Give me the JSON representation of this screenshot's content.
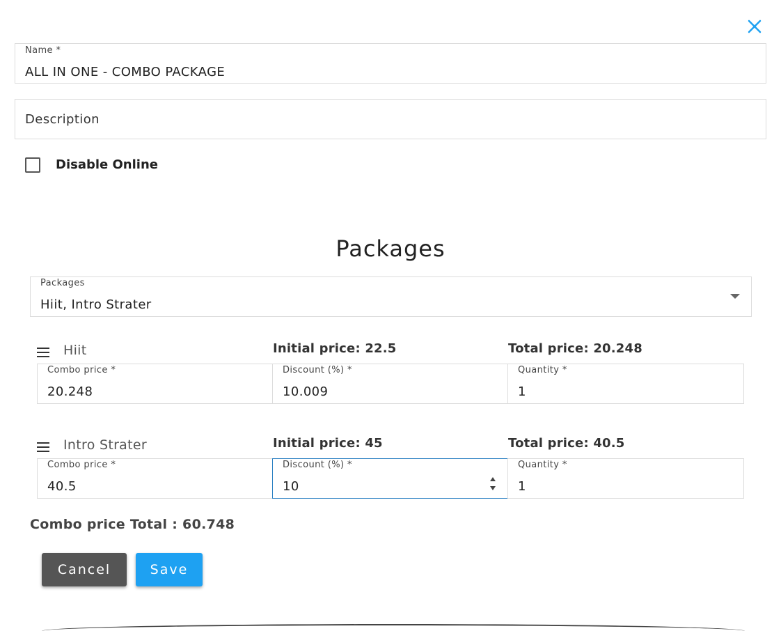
{
  "dialog": {
    "accent_color": "#1ea1f2",
    "close_icon": "close-icon"
  },
  "name_field": {
    "label": "Name *",
    "value": "ALL IN ONE - COMBO PACKAGE"
  },
  "description_field": {
    "placeholder": "Description",
    "value": ""
  },
  "disable_online": {
    "label": "Disable Online",
    "checked": false
  },
  "packages_section": {
    "title": "Packages",
    "select": {
      "label": "Packages",
      "value": "Hiit, Intro Strater"
    },
    "items": [
      {
        "name": "Hiit",
        "initial_price": "Initial price: 22.5",
        "total_price": "Total price: 20.248",
        "combo_price": {
          "label": "Combo price *",
          "value": "20.248"
        },
        "discount": {
          "label": "Discount (%) *",
          "value": "10.009"
        },
        "quantity": {
          "label": "Quantity *",
          "value": "1"
        }
      },
      {
        "name": "Intro Strater",
        "initial_price": "Initial price: 45",
        "total_price": "Total price: 40.5",
        "combo_price": {
          "label": "Combo price *",
          "value": "40.5"
        },
        "discount": {
          "label": "Discount (%) *",
          "value": "10"
        },
        "quantity": {
          "label": "Quantity *",
          "value": "1"
        }
      }
    ]
  },
  "combo_total": "Combo price Total : 60.748",
  "actions": {
    "cancel_label": "Cancel",
    "save_label": "Save"
  }
}
